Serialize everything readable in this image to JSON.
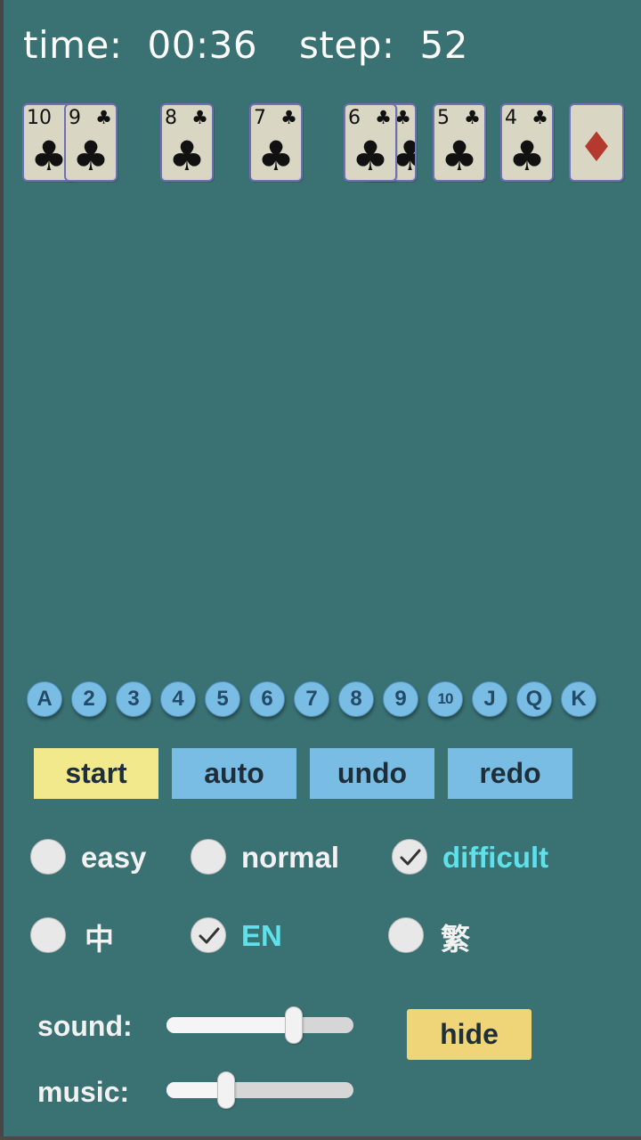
{
  "hud": {
    "time_label": "time:",
    "time_value": "00:36",
    "step_label": "step:",
    "step_value": "52"
  },
  "cards": [
    {
      "rank": "10",
      "suit": "♣",
      "color": "#111111"
    },
    {
      "rank": "9",
      "suit": "♣",
      "color": "#111111"
    },
    {
      "rank": "8",
      "suit": "♣",
      "color": "#111111"
    },
    {
      "rank": "7",
      "suit": "♣",
      "color": "#111111"
    },
    {
      "rank": "",
      "suit": "♣",
      "color": "#111111"
    },
    {
      "rank": "6",
      "suit": "♣",
      "color": "#111111"
    },
    {
      "rank": "5",
      "suit": "♣",
      "color": "#111111"
    },
    {
      "rank": "4",
      "suit": "♣",
      "color": "#111111"
    },
    {
      "rank": "",
      "suit": "♦",
      "color": "#b4392e"
    }
  ],
  "rank_buttons": [
    "A",
    "2",
    "3",
    "4",
    "5",
    "6",
    "7",
    "8",
    "9",
    "10",
    "J",
    "Q",
    "K"
  ],
  "buttons": {
    "start": "start",
    "auto": "auto",
    "undo": "undo",
    "redo": "redo",
    "hide": "hide"
  },
  "difficulty": {
    "options": [
      "easy",
      "normal",
      "difficult"
    ],
    "selected": "difficult"
  },
  "language": {
    "options": [
      "中",
      "EN",
      "繁"
    ],
    "selected": "EN"
  },
  "sliders": {
    "sound_label": "sound:",
    "sound_level": 0.68,
    "music_label": "music:",
    "music_level": 0.32
  },
  "colors": {
    "table": "#3a7172",
    "rank_button": "#79bde4",
    "primary_button": "#79bde4",
    "start_button": "#f1e98c",
    "hide_button": "#efd478",
    "active_option": "#5fe1ec"
  }
}
